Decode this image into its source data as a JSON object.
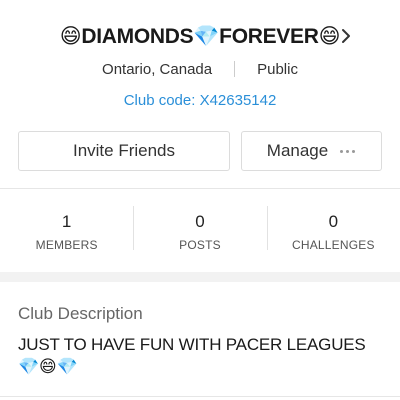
{
  "club": {
    "name": "😄DIAMONDS💎FOREVER😄",
    "location": "Ontario, Canada",
    "privacy": "Public",
    "club_code": "Club code: X42635142"
  },
  "actions": {
    "invite_label": "Invite Friends",
    "manage_label": "Manage"
  },
  "stats": [
    {
      "value": "1",
      "label": "MEMBERS"
    },
    {
      "value": "0",
      "label": "POSTS"
    },
    {
      "value": "0",
      "label": "CHALLENGES"
    }
  ],
  "description": {
    "title": "Club Description",
    "text": "JUST TO HAVE FUN WITH  PACER LEAGUES 💎😄💎"
  },
  "colors": {
    "accent": "#2a8fd8",
    "divider": "#e6e6e6",
    "band": "#f2f2f2"
  },
  "icons": {
    "chevron": "chevron-right-icon",
    "more": "more-dots-icon"
  }
}
